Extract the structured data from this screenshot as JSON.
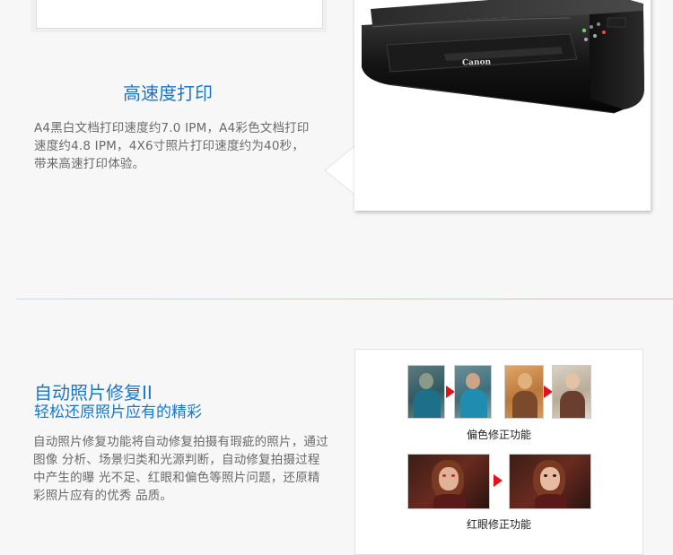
{
  "section1": {
    "title": "高速度打印",
    "description": "A4黑白文档打印速度约7.0 IPM，A4彩色文档打印速度约4.8 IPM，4X6寸照片打印速度约为40秒，带来高速打印体验。",
    "printer_brand": "Canon"
  },
  "section2": {
    "title": "自动照片修复II",
    "subtitle": "轻松还原照片应有的精彩",
    "description": "自动照片修复功能将自动修复拍摄有瑕疵的照片，通过图像 分析、场景归类和光源判断，自动修复拍摄过程中产生的曝 光不足、红眼和偏色等照片问题，还原精彩照片应有的优秀 品质。",
    "captions": {
      "color_cast": "偏色修正功能",
      "red_eye": "红眼修正功能"
    }
  },
  "colors": {
    "heading_blue": "#1a76c9",
    "body_gray": "#6a6a6a",
    "arrow_red": "#e1121b"
  }
}
